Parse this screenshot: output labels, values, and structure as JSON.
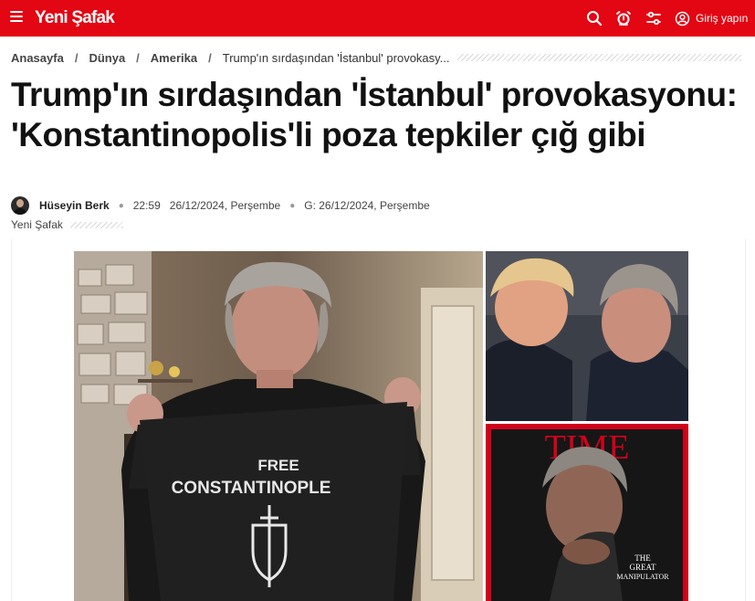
{
  "header": {
    "logo_text": "Yeni Şafak",
    "login_label": "Giriş yapın",
    "brand_color": "#e30613",
    "icons": [
      "menu-icon",
      "search-icon",
      "alarm-icon",
      "settings-sliders-icon",
      "user-icon"
    ]
  },
  "breadcrumb": {
    "items": [
      "Anasayfa",
      "Dünya",
      "Amerika"
    ],
    "separator": "/",
    "current": "Trump'ın sırdaşından 'İstanbul' provokasy..."
  },
  "article": {
    "title": "Trump'ın sırdaşından 'İstanbul' provokasyonu: 'Konstantinopolis'li poza tepkiler çığ gibi",
    "author": "Hüseyin Berk",
    "time": "22:59",
    "date": "26/12/2024, Perşembe",
    "updated": "G: 26/12/2024, Perşembe",
    "source": "Yeni Şafak"
  },
  "image": {
    "shirt_text_line1": "FREE",
    "shirt_text_line2": "CONSTANTINOPLE",
    "magazine_title": "TIME",
    "magazine_subtitle_line1": "THE",
    "magazine_subtitle_line2": "GREAT",
    "magazine_subtitle_line3": "MANIPULATOR",
    "magazine_border_color": "#d0021b"
  }
}
